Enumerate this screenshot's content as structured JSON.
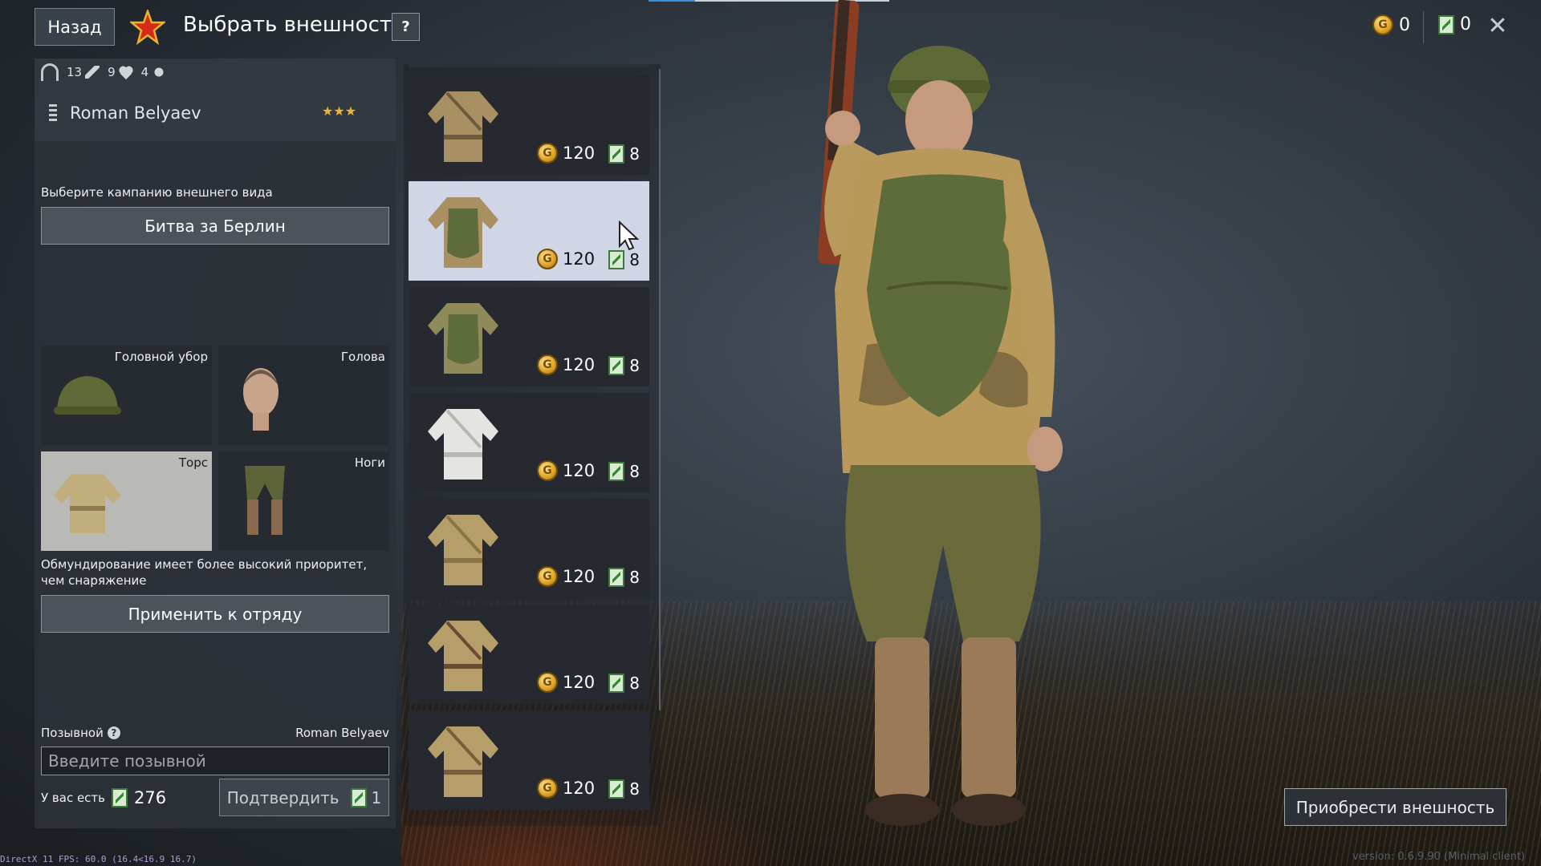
{
  "header": {
    "back_label": "Назад",
    "title": "Выбрать внешность",
    "help_label": "?",
    "gold_amount": "0",
    "ticket_amount": "0",
    "close_label": "✕"
  },
  "soldier": {
    "stats": [
      "13",
      "9",
      "4"
    ],
    "name": "Roman Belyaev",
    "rank_stars": "★★★"
  },
  "campaign": {
    "label": "Выберите кампанию внешнего вида",
    "selected": "Битва за Берлин"
  },
  "slots": {
    "hat": "Головной убор",
    "head": "Голова",
    "torso": "Торс",
    "legs": "Ноги"
  },
  "priority_note": "Обмундирование имеет более высокий приоритет, чем снаряжение",
  "apply_label": "Применить к отряду",
  "callsign": {
    "label": "Позывной",
    "current": "Roman Belyaev",
    "placeholder": "Введите позывной",
    "have_label": "У вас есть",
    "have_amount": "276",
    "confirm_label": "Подтвердить",
    "confirm_cost": "1"
  },
  "items": [
    {
      "price": "120",
      "tickets": "8",
      "variant": "camo"
    },
    {
      "price": "120",
      "tickets": "8",
      "variant": "armor-camo"
    },
    {
      "price": "120",
      "tickets": "8",
      "variant": "armor"
    },
    {
      "price": "120",
      "tickets": "8",
      "variant": "white"
    },
    {
      "price": "120",
      "tickets": "8",
      "variant": "khaki"
    },
    {
      "price": "120",
      "tickets": "8",
      "variant": "khaki-gear"
    },
    {
      "price": "120",
      "tickets": "8",
      "variant": "khaki-strap"
    }
  ],
  "buy_label": "Приобрести внешность",
  "fps_text": "DirectX 11 FPS: 60.0 (16.4<16.9 16.7)",
  "version_text": "version: 0.6.9.90 (Minimal client)",
  "colors": {
    "accent_blue": "#3b8ed9",
    "gold": "#e0a628",
    "ticket_green": "#2f8a2c",
    "selected_item_bg": "#d1d6e6",
    "star_red": "#d62a1c"
  }
}
